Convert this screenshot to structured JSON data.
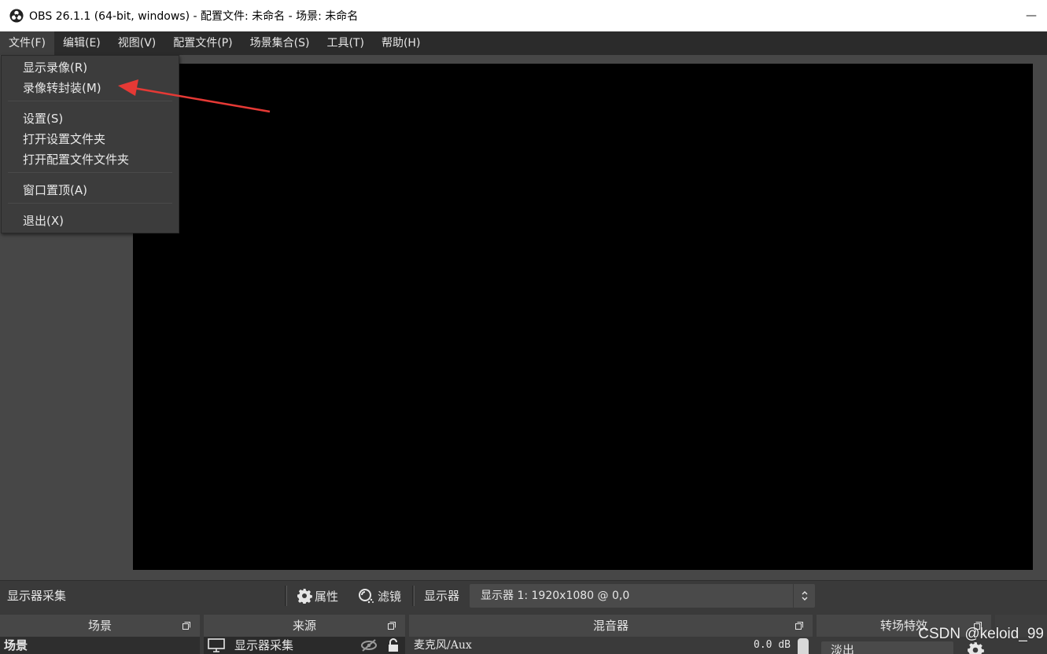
{
  "window": {
    "title": "OBS 26.1.1 (64-bit, windows) - 配置文件: 未命名 - 场景: 未命名",
    "minimize_glyph": "—"
  },
  "menubar": {
    "items": [
      "文件(F)",
      "编辑(E)",
      "视图(V)",
      "配置文件(P)",
      "场景集合(S)",
      "工具(T)",
      "帮助(H)"
    ]
  },
  "file_menu": {
    "items": [
      "显示录像(R)",
      "录像转封装(M)",
      "设置(S)",
      "打开设置文件夹",
      "打开配置文件文件夹",
      "窗口置顶(A)",
      "退出(X)"
    ]
  },
  "source_toolbar": {
    "selected_source": "显示器采集",
    "properties_label": "属性",
    "filters_label": "滤镜",
    "display_label": "显示器",
    "display_value": "显示器 1: 1920x1080 @ 0,0"
  },
  "docks": {
    "scenes": {
      "title": "场景",
      "item": "场景"
    },
    "sources": {
      "title": "来源",
      "item": "显示器采集"
    },
    "mixer": {
      "title": "混音器",
      "channel": "麦克风/Aux",
      "db": "0.0 dB"
    },
    "transitions": {
      "title": "转场特效",
      "value": "淡出"
    }
  },
  "watermark": "CSDN @keloid_99",
  "colors": {
    "menubar": "#2b2b2b",
    "preview": "#000000",
    "background": "#474747",
    "annotation_arrow": "#e53935"
  },
  "icons": [
    "obs-logo-icon",
    "gear-icon",
    "filter-icon",
    "monitor-icon",
    "eye-hidden-icon",
    "lock-icon",
    "float-dock-icon",
    "spinner-icon"
  ]
}
